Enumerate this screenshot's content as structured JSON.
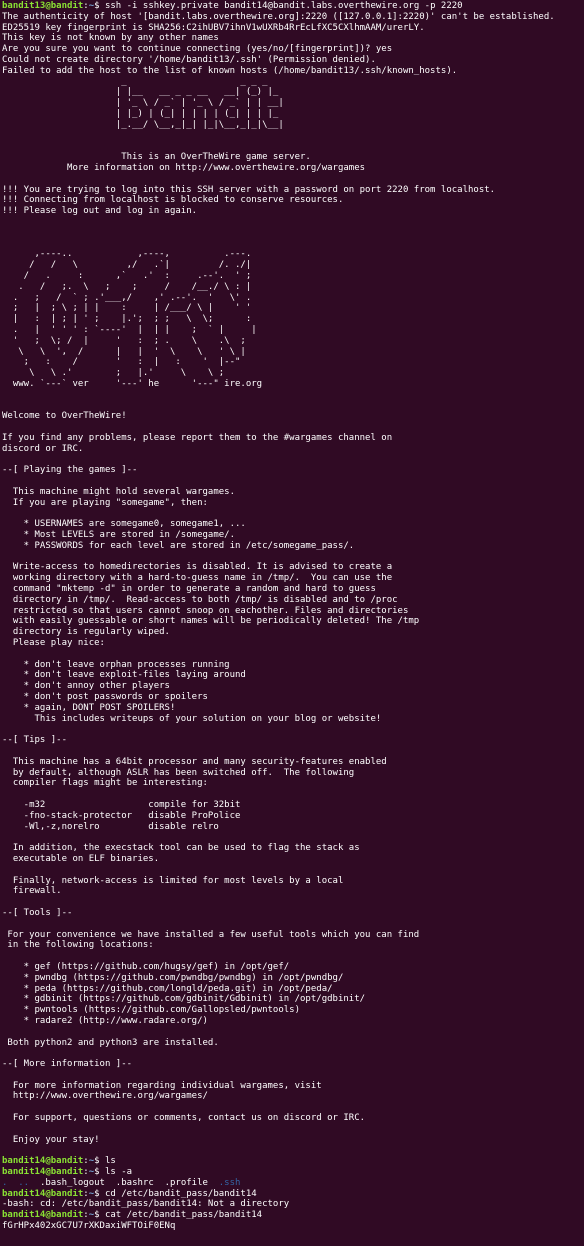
{
  "terminal": {
    "prompt": {
      "user13": "bandit13@bandit",
      "user14": "bandit14@bandit",
      "path": "~",
      "symbol": "$"
    },
    "colors": {
      "background": "#300a24",
      "text": "#ffffff",
      "user": "#8ae234",
      "path": "#729fcf",
      "dir": "#3465a4"
    },
    "ssh_command": " ssh -i sshkey.private bandit14@bandit.labs.overthewire.org -p 2220",
    "pre_banner": [
      "The authenticity of host '[bandit.labs.overthewire.org]:2220 ([127.0.0.1]:2220)' can't be established.",
      "ED25519 key fingerprint is SHA256:C2ihUBV7ihnV1wUXRb4RrEcLfXC5CXlhmAAM/urerLY.",
      "This key is not known by any other names",
      "Are you sure you want to continue connecting (yes/no/[fingerprint])? yes",
      "Could not create directory '/home/bandit13/.ssh' (Permission denied).",
      "Failed to add the host to the list of known hosts (/home/bandit13/.ssh/known_hosts)."
    ],
    "banner_logo": [
      "                      _                     _ _ _   ",
      "                     | |__   __ _ _ __   __| (_) |_ ",
      "                     | '_ \\ / _` | '_ \\ / _` | | __|",
      "                     | |_) | (_| | | | | (_| | | |_ ",
      "                     |_.__/ \\__,_|_| |_|\\__,_|_|\\__|",
      "",
      "",
      "                      This is an OverTheWire game server.",
      "            More information on http://www.overthewire.org/wargames",
      "",
      "!!! You are trying to log into this SSH server with a password on port 2220 from localhost.",
      "!!! Connecting from localhost is blocked to conserve resources.",
      "!!! Please log out and log in again.",
      "",
      "",
      "",
      "      ,----..            ,----,          .---.",
      "     /   /   \\         ,/   .`|         /. ./|",
      "    /   .     :      ,`   .'  :     .--'.  ' ;",
      "   .   /   ;.  \\   ;    ;     /    /__./ \\ : |",
      "  .   ;   /  ` ; .'___,/    ,' .--'.  '   \\' .",
      "  ;   |  ; \\ ; | |    :     | /___/ \\ |    ' '",
      "  |   :  | ; | ' ;    |.';  ; ;   \\  \\;      :",
      "  .   |  ' ' ' : `----'  |  | |    ;  ` |     |",
      "  '   ;  \\; /  |     '   :  ; .    \\    .\\  ;",
      "   \\   \\  ',  /      |   |  '  \\    \\   ' \\ |",
      "    ;   :    /       '   :  |   :    '  |--\"",
      "     \\   \\ .'        ;   |.'     \\    \\ ;",
      "  www. `---` ver     '---' he      '---\" ire.org",
      "",
      "",
      "Welcome to OverTheWire!",
      "",
      "If you find any problems, please report them to the #wargames channel on",
      "discord or IRC.",
      "",
      "--[ Playing the games ]--",
      "",
      "  This machine might hold several wargames.",
      "  If you are playing \"somegame\", then:",
      "",
      "    * USERNAMES are somegame0, somegame1, ...",
      "    * Most LEVELS are stored in /somegame/.",
      "    * PASSWORDS for each level are stored in /etc/somegame_pass/.",
      "",
      "  Write-access to homedirectories is disabled. It is advised to create a",
      "  working directory with a hard-to-guess name in /tmp/.  You can use the",
      "  command \"mktemp -d\" in order to generate a random and hard to guess",
      "  directory in /tmp/.  Read-access to both /tmp/ is disabled and to /proc",
      "  restricted so that users cannot snoop on eachother. Files and directories",
      "  with easily guessable or short names will be periodically deleted! The /tmp",
      "  directory is regularly wiped.",
      "  Please play nice:",
      "",
      "    * don't leave orphan processes running",
      "    * don't leave exploit-files laying around",
      "    * don't annoy other players",
      "    * don't post passwords or spoilers",
      "    * again, DONT POST SPOILERS!",
      "      This includes writeups of your solution on your blog or website!",
      "",
      "--[ Tips ]--",
      "",
      "  This machine has a 64bit processor and many security-features enabled",
      "  by default, although ASLR has been switched off.  The following",
      "  compiler flags might be interesting:",
      "",
      "    -m32                   compile for 32bit",
      "    -fno-stack-protector   disable ProPolice",
      "    -Wl,-z,norelro         disable relro",
      "",
      "  In addition, the execstack tool can be used to flag the stack as",
      "  executable on ELF binaries.",
      "",
      "  Finally, network-access is limited for most levels by a local",
      "  firewall.",
      "",
      "--[ Tools ]--",
      "",
      " For your convenience we have installed a few useful tools which you can find",
      " in the following locations:",
      "",
      "    * gef (https://github.com/hugsy/gef) in /opt/gef/",
      "    * pwndbg (https://github.com/pwndbg/pwndbg) in /opt/pwndbg/",
      "    * peda (https://github.com/longld/peda.git) in /opt/peda/",
      "    * gdbinit (https://github.com/gdbinit/Gdbinit) in /opt/gdbinit/",
      "    * pwntools (https://github.com/Gallopsled/pwntools)",
      "    * radare2 (http://www.radare.org/)",
      "",
      " Both python2 and python3 are installed.",
      "",
      "--[ More information ]--",
      "",
      "  For more information regarding individual wargames, visit",
      "  http://www.overthewire.org/wargames/",
      "",
      "  For support, questions or comments, contact us on discord or IRC.",
      "",
      "  Enjoy your stay!",
      ""
    ],
    "cmd_ls": " ls",
    "cmd_ls_a": " ls -a",
    "ls_a_output": {
      "dot": ".",
      "dotdot": "..",
      "files": ".bash_logout  .bashrc  .profile  ",
      "ssh_dir": ".ssh"
    },
    "cmd_cd": " cd /etc/bandit_pass/bandit14",
    "cd_error": "-bash: cd: /etc/bandit_pass/bandit14: Not a directory",
    "cmd_cat": " cat /etc/bandit_pass/bandit14",
    "cat_output": "fGrHPx402xGC7U7rXKDaxiWFTOiF0ENq"
  }
}
